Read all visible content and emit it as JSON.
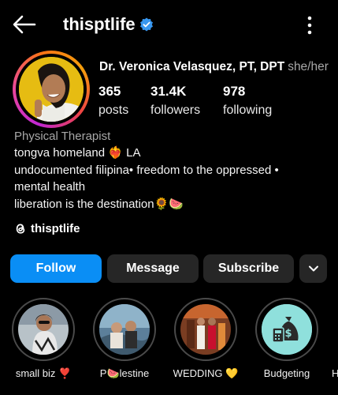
{
  "header": {
    "username": "thisptlife",
    "icons": {
      "back": "back-arrow-icon",
      "verified": "verified-badge-icon",
      "more": "more-vertical-icon"
    }
  },
  "profile": {
    "full_name": "Dr. Veronica Velasquez, PT, DPT",
    "pronouns": "she/her",
    "stats": [
      {
        "value": "365",
        "label": "posts"
      },
      {
        "value": "31.4K",
        "label": "followers"
      },
      {
        "value": "978",
        "label": "following"
      }
    ],
    "category": "Physical Therapist",
    "bio_lines": [
      "tongva homeland ❤️‍🔥 LA",
      "undocumented filipina• freedom to the oppressed • mental health",
      "liberation is the destination🌻🍉"
    ],
    "threads_handle": "thisptlife",
    "icons": {
      "threads": "threads-icon"
    }
  },
  "actions": {
    "follow": "Follow",
    "message": "Message",
    "subscribe": "Subscribe",
    "more_icon": "chevron-down-icon"
  },
  "highlights": [
    {
      "label": "small biz ❣️"
    },
    {
      "label": "P🍉lestine"
    },
    {
      "label": "WEDDING 💛"
    },
    {
      "label": "Budgeting"
    }
  ],
  "highlights_cutoff": "H",
  "colors": {
    "background": "#000000",
    "follow_button": "#0a8ef5",
    "secondary_button": "#262626",
    "verified": "#3897f0",
    "muted_text": "#a8a8a8"
  }
}
